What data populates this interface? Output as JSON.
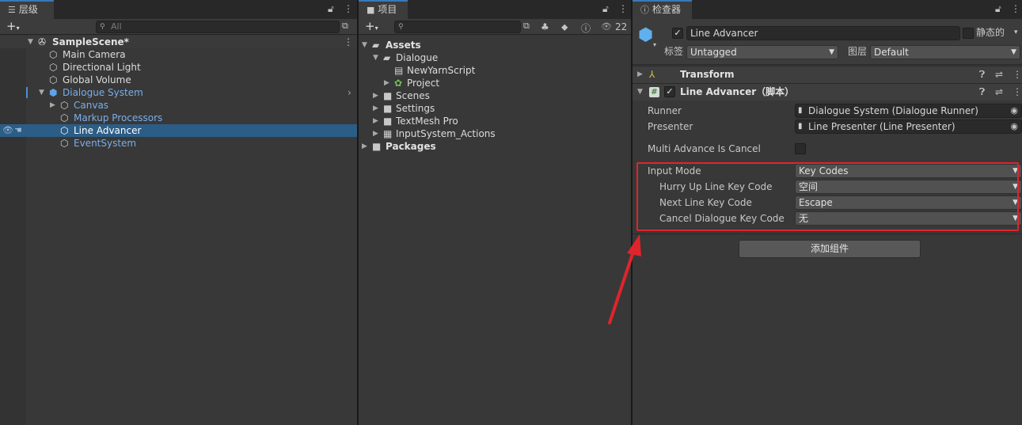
{
  "hierarchy": {
    "tab_label": "层级",
    "search_placeholder": "All",
    "scene": "SampleScene*",
    "items": [
      {
        "label": "Main Camera"
      },
      {
        "label": "Directional Light"
      },
      {
        "label": "Global Volume"
      },
      {
        "label": "Dialogue System"
      },
      {
        "label": "Canvas"
      },
      {
        "label": "Markup Processors"
      },
      {
        "label": "Line Advancer"
      },
      {
        "label": "EventSystem"
      }
    ]
  },
  "project": {
    "tab_label": "项目",
    "hidden_count": "22",
    "tree": {
      "assets": "Assets",
      "dialogue": "Dialogue",
      "new_yarn_script": "NewYarnScript",
      "project": "Project",
      "scenes": "Scenes",
      "settings": "Settings",
      "textmesh_pro": "TextMesh Pro",
      "input_actions": "InputSystem_Actions",
      "packages": "Packages"
    }
  },
  "inspector": {
    "tab_label": "检查器",
    "object_name": "Line Advancer",
    "static_label": "静态的",
    "tag_label": "标签",
    "tag_value": "Untagged",
    "layer_label": "图层",
    "layer_value": "Default",
    "transform_title": "Transform",
    "component_title": "Line Advancer（脚本）",
    "runner_label": "Runner",
    "runner_value": "Dialogue System (Dialogue Runner)",
    "presenter_label": "Presenter",
    "presenter_value": "Line Presenter (Line Presenter)",
    "multi_advance_label": "Multi Advance Is Cancel",
    "input_mode_label": "Input Mode",
    "input_mode_value": "Key Codes",
    "hurry_up_label": "Hurry Up Line Key Code",
    "hurry_up_value": "空间",
    "next_line_label": "Next Line Key Code",
    "next_line_value": "Escape",
    "cancel_label": "Cancel Dialogue Key Code",
    "cancel_value": "无",
    "add_component": "添加组件"
  },
  "colors": {
    "annotation_red": "#e0242b",
    "selection_blue": "#2c5d87",
    "accent_blue": "#7aaeea"
  }
}
